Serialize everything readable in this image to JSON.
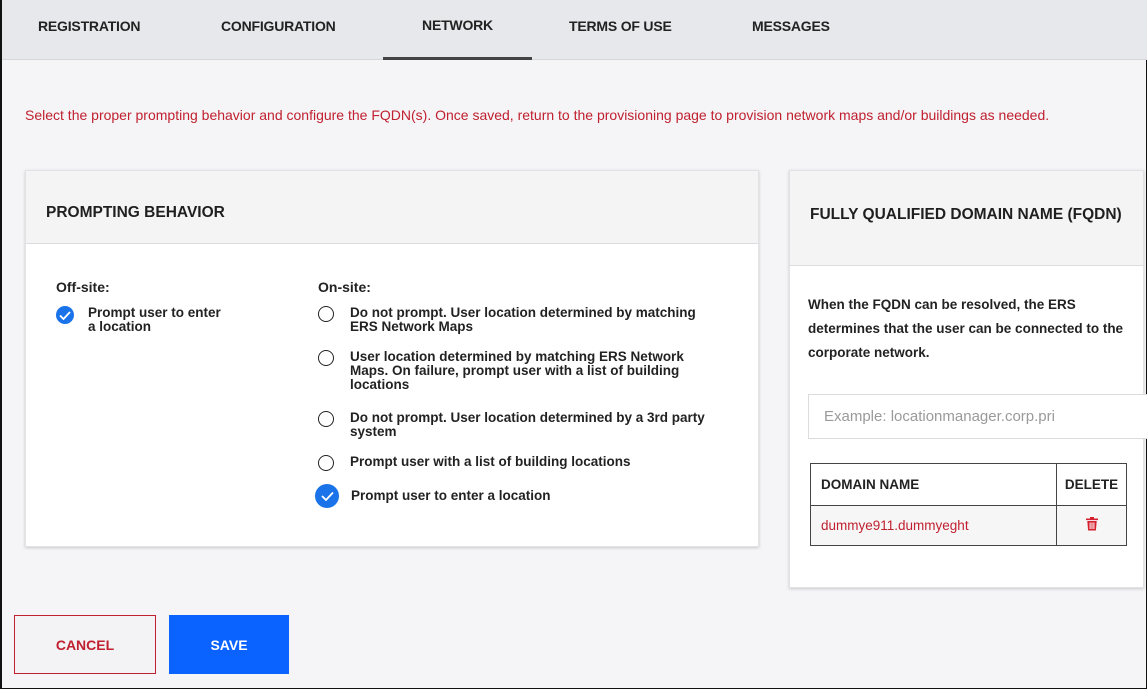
{
  "tabs": [
    {
      "label": "REGISTRATION"
    },
    {
      "label": "CONFIGURATION"
    },
    {
      "label": "NETWORK"
    },
    {
      "label": "TERMS OF USE"
    },
    {
      "label": "MESSAGES"
    }
  ],
  "active_tab": "NETWORK",
  "intro_text": "Select the proper prompting behavior and configure the FQDN(s). Once saved, return to the provisioning page to provision network maps and/or buildings as needed.",
  "prompting": {
    "title": "PROMPTING BEHAVIOR",
    "offsite_label": "Off-site:",
    "offsite_option": "Prompt user to enter a location",
    "onsite_label": "On-site:",
    "onsite_options": [
      {
        "label": "Do not prompt. User location determined by matching ERS Network Maps",
        "selected": false
      },
      {
        "label": "User location determined by matching ERS Network Maps. On failure, prompt user with a list of building locations",
        "selected": false
      },
      {
        "label": "Do not prompt. User location determined by a 3rd party system",
        "selected": false
      },
      {
        "label": "Prompt user with a list of building locations",
        "selected": false
      },
      {
        "label": "Prompt user to enter a location",
        "selected": true
      }
    ]
  },
  "fqdn": {
    "title": "FULLY QUALIFIED DOMAIN NAME (FQDN)",
    "description": "When the FQDN can be resolved, the ERS determines that the user can be connected to the corporate network.",
    "input_placeholder": "Example: locationmanager.corp.pri",
    "input_value": "",
    "table": {
      "headers": [
        "DOMAIN NAME",
        "DELETE"
      ],
      "rows": [
        {
          "domain": "dummye911.dummyeght"
        }
      ]
    }
  },
  "buttons": {
    "cancel": "CANCEL",
    "save": "SAVE"
  },
  "colors": {
    "accent_blue": "#0a62ff",
    "error_red": "#c0202f",
    "check_blue": "#1a73e8"
  }
}
